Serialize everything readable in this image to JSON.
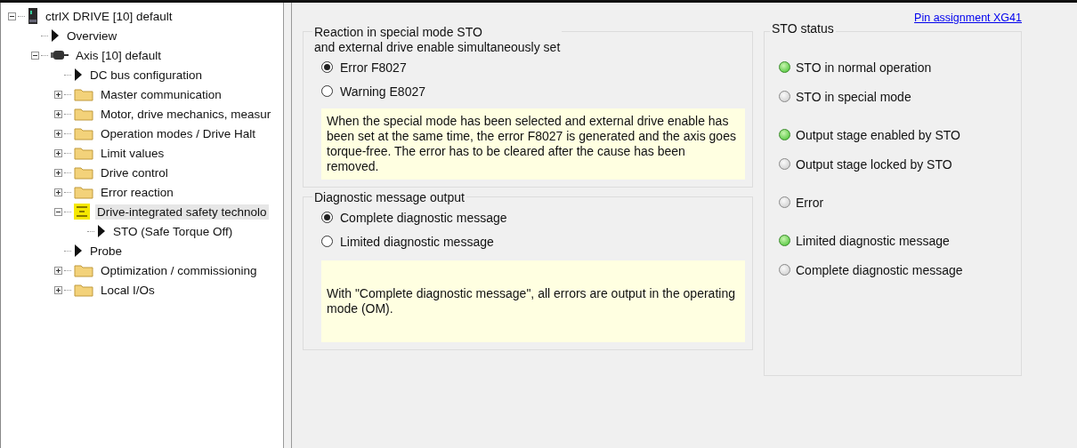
{
  "tree": [
    {
      "label": "ctrlX DRIVE [10] default",
      "kind": "device",
      "expanded": true,
      "selected": false,
      "children": [
        {
          "label": "Overview",
          "kind": "page",
          "selected": false
        },
        {
          "label": "Axis [10] default",
          "kind": "axis",
          "expanded": true,
          "selected": false,
          "children": [
            {
              "label": "DC bus configuration",
              "kind": "page",
              "selected": false
            },
            {
              "label": "Master communication",
              "kind": "folder",
              "expanded": false,
              "selected": false
            },
            {
              "label": "Motor, drive mechanics, measur",
              "kind": "folder",
              "expanded": false,
              "selected": false
            },
            {
              "label": "Operation modes / Drive Halt",
              "kind": "folder",
              "expanded": false,
              "selected": false
            },
            {
              "label": "Limit values",
              "kind": "folder",
              "expanded": false,
              "selected": false
            },
            {
              "label": "Drive control",
              "kind": "folder",
              "expanded": false,
              "selected": false
            },
            {
              "label": "Error reaction",
              "kind": "folder",
              "expanded": false,
              "selected": false
            },
            {
              "label": "Drive-integrated safety technolo",
              "kind": "safety",
              "expanded": true,
              "selected": true,
              "children": [
                {
                  "label": "STO (Safe Torque Off)",
                  "kind": "page",
                  "selected": false
                }
              ]
            },
            {
              "label": "Probe",
              "kind": "page",
              "selected": false
            },
            {
              "label": "Optimization / commissioning",
              "kind": "folder",
              "expanded": false,
              "selected": false
            },
            {
              "label": "Local I/Os",
              "kind": "folder",
              "expanded": false,
              "selected": false
            }
          ]
        }
      ]
    }
  ],
  "link": "Pin assignment XG41",
  "reaction_group": {
    "title_lines": [
      "Reaction in special mode STO",
      "and external drive enable simultaneously set"
    ],
    "options": [
      {
        "label": "Error F8027",
        "selected": true
      },
      {
        "label": "Warning E8027",
        "selected": false
      }
    ],
    "note": "When the special mode has been selected and external drive enable has been set at the same time, the error F8027 is generated and the axis goes torque-free. The error has to be cleared after the cause has been removed."
  },
  "diagnostic_group": {
    "title": "Diagnostic message output",
    "options": [
      {
        "label": "Complete diagnostic message",
        "selected": true
      },
      {
        "label": "Limited diagnostic message",
        "selected": false
      }
    ],
    "note": "With \"Complete diagnostic message\", all errors are output in the operating mode (OM)."
  },
  "sto_status": {
    "title": "STO status",
    "groups": [
      {
        "items": [
          {
            "label": "STO in normal operation",
            "on": true
          },
          {
            "label": "STO in special mode",
            "on": false
          }
        ]
      },
      {
        "items": [
          {
            "label": "Output stage enabled by STO",
            "on": true
          },
          {
            "label": "Output stage locked by STO",
            "on": false
          }
        ]
      },
      {
        "items": [
          {
            "label": "Error",
            "on": false
          }
        ]
      },
      {
        "items": [
          {
            "label": "Limited diagnostic message",
            "on": true
          },
          {
            "label": "Complete diagnostic message",
            "on": false
          }
        ]
      }
    ]
  }
}
